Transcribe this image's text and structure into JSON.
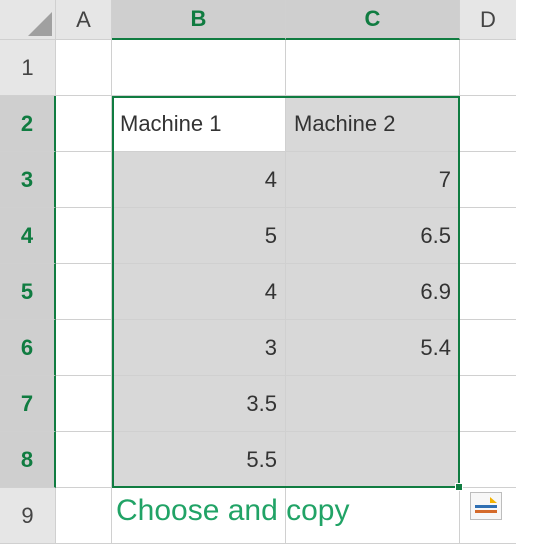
{
  "columns": [
    "A",
    "B",
    "C",
    "D"
  ],
  "rowNumbers": [
    "1",
    "2",
    "3",
    "4",
    "5",
    "6",
    "7",
    "8",
    "9"
  ],
  "cells": {
    "B2": "Machine 1",
    "C2": "Machine 2",
    "B3": "4",
    "C3": "7",
    "B4": "5",
    "C4": "6.5",
    "B5": "4",
    "C5": "6.9",
    "B6": "3",
    "C6": "5.4",
    "B7": "3.5",
    "B8": "5.5"
  },
  "annotation": "Choose and copy",
  "chart_data": {
    "type": "table",
    "title": "",
    "columns": [
      "Machine 1",
      "Machine 2"
    ],
    "rows": [
      [
        4,
        7
      ],
      [
        5,
        6.5
      ],
      [
        4,
        6.9
      ],
      [
        3,
        5.4
      ],
      [
        3.5,
        null
      ],
      [
        5.5,
        null
      ]
    ]
  }
}
